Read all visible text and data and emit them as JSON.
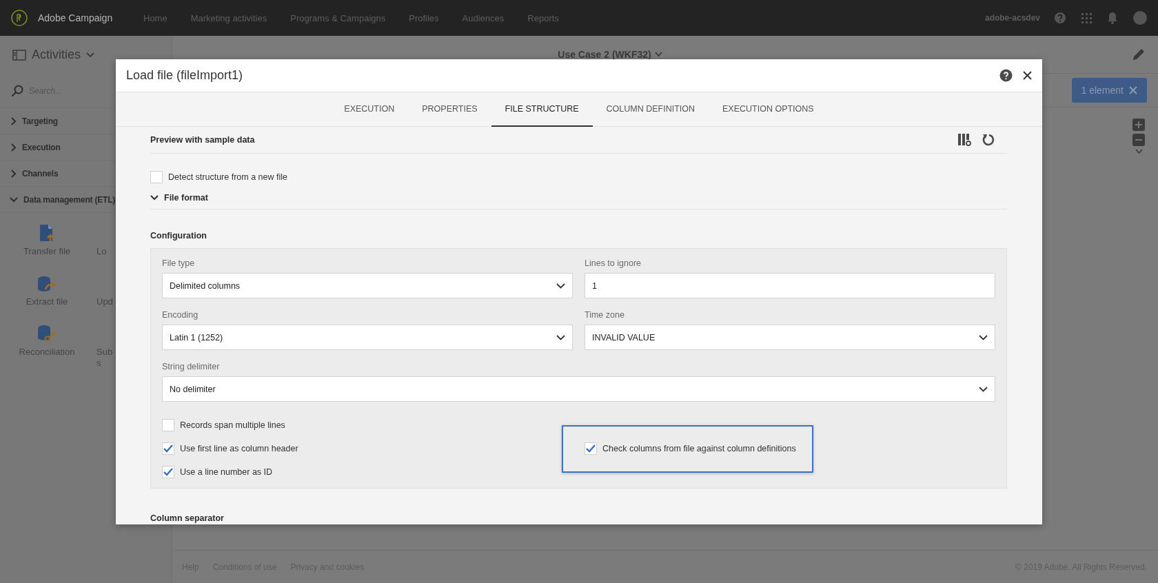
{
  "topbar": {
    "brand": "Adobe Campaign",
    "nav": [
      "Home",
      "Marketing activities",
      "Programs & Campaigns",
      "Profiles",
      "Audiences",
      "Reports"
    ],
    "user": "adobe-acsdev"
  },
  "sidebar": {
    "title": "Activities",
    "search_placeholder": "Search...",
    "categories": [
      {
        "label": "Targeting",
        "expanded": false
      },
      {
        "label": "Execution",
        "expanded": false
      },
      {
        "label": "Channels",
        "expanded": false
      },
      {
        "label": "Data management (ETL)",
        "expanded": true
      }
    ],
    "activities": [
      {
        "lines": [
          "Transfer file"
        ],
        "kind": "upload"
      },
      {
        "lines": [
          "Lo"
        ],
        "kind": "covered"
      },
      {
        "lines": [
          "Extract file"
        ],
        "kind": "extract"
      },
      {
        "lines": [
          "Upd"
        ],
        "kind": "covered"
      },
      {
        "lines": [
          "Reconciliation"
        ],
        "kind": "reconcile"
      },
      {
        "lines": [
          "Sub",
          "s"
        ],
        "kind": "covered"
      }
    ]
  },
  "workflow": {
    "title": "Use Case 2 (WKF32)",
    "selection_badge": "1 element"
  },
  "footer": {
    "links": [
      "Help",
      "Conditions of use",
      "Privacy and cookies"
    ],
    "copyright": "© 2019 Adobe. All Rights Reserved."
  },
  "dialog": {
    "title": "Load file (fileImport1)",
    "tabs": [
      {
        "label": "EXECUTION",
        "selected": false
      },
      {
        "label": "PROPERTIES",
        "selected": false
      },
      {
        "label": "FILE STRUCTURE",
        "selected": true
      },
      {
        "label": "COLUMN DEFINITION",
        "selected": false
      },
      {
        "label": "EXECUTION OPTIONS",
        "selected": false
      }
    ],
    "preview_title": "Preview with sample data",
    "detect": {
      "label": "Detect structure from a new file",
      "checked": false
    },
    "file_format": {
      "label": "File format",
      "expanded": true
    },
    "configuration": {
      "title": "Configuration",
      "fields": [
        {
          "label": "File type",
          "value": "Delimited columns",
          "kind": "select",
          "wide": false
        },
        {
          "label": "Lines to ignore",
          "value": "1",
          "kind": "text",
          "wide": false
        },
        {
          "label": "Encoding",
          "value": "Latin 1 (1252)",
          "kind": "select",
          "wide": false
        },
        {
          "label": "Time zone",
          "value": "INVALID VALUE",
          "kind": "select",
          "wide": false
        },
        {
          "label": "String delimiter",
          "value": "No delimiter",
          "kind": "select",
          "wide": true
        }
      ],
      "options": [
        {
          "label": "Records span multiple lines",
          "checked": false
        },
        {
          "label": "Use first line as column header",
          "checked": true
        },
        {
          "label": "Use a line number as ID",
          "checked": true
        }
      ],
      "highlighted_option": {
        "label": "Check columns from file against column definitions",
        "checked": true
      }
    },
    "next_section": "Column separator"
  }
}
